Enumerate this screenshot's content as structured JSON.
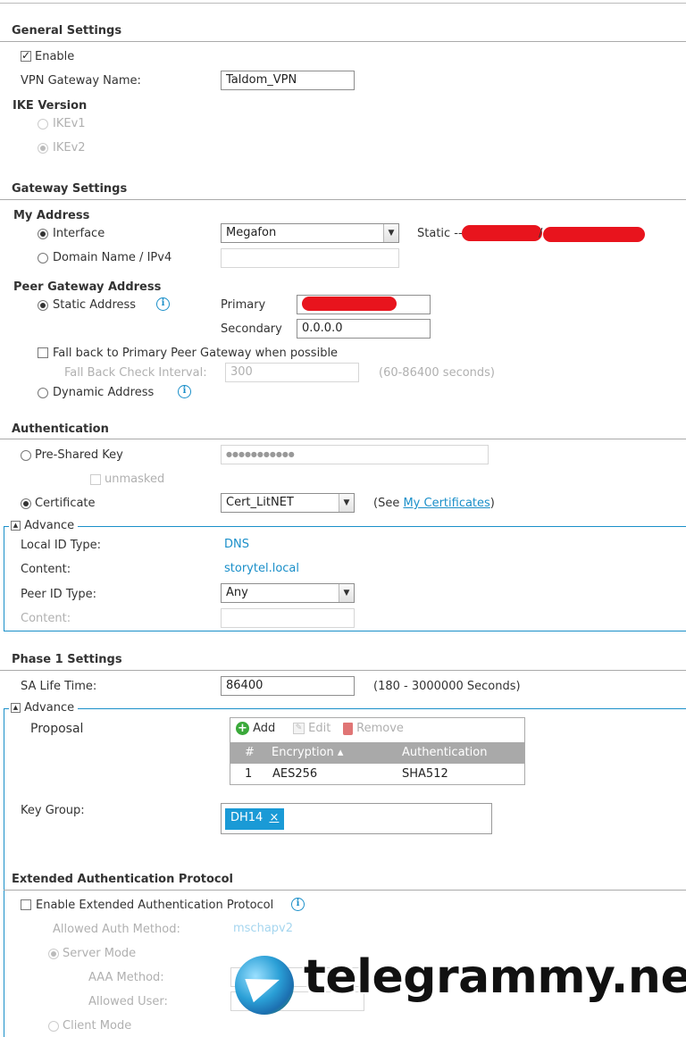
{
  "general": {
    "title": "General Settings",
    "enable_label": "Enable",
    "gateway_name_label": "VPN Gateway Name:",
    "gateway_name_value": "Taldom_VPN",
    "ike_title": "IKE Version",
    "ikev1": "IKEv1",
    "ikev2": "IKEv2"
  },
  "gateway": {
    "title": "Gateway Settings",
    "my_address_title": "My Address",
    "interface_label": "Interface",
    "interface_value": "Megafon",
    "static_label": "Static --",
    "static_sep": "/",
    "domain_label": "Domain Name / IPv4",
    "peer_title": "Peer Gateway Address",
    "static_address_label": "Static Address",
    "primary_label": "Primary",
    "secondary_label": "Secondary",
    "secondary_value": "0.0.0.0",
    "fallback_label": "Fall back to Primary Peer Gateway when possible",
    "fallback_interval_label": "Fall Back Check Interval:",
    "fallback_interval_value": "300",
    "fallback_range": "(60-86400 seconds)",
    "dynamic_label": "Dynamic Address"
  },
  "auth": {
    "title": "Authentication",
    "psk_label": "Pre-Shared Key",
    "psk_value": "●●●●●●●●●●●",
    "unmasked_label": "unmasked",
    "cert_label": "Certificate",
    "cert_value": "Cert_LitNET",
    "see_prefix": "(See ",
    "see_link": "My Certificates",
    "see_suffix": ")",
    "advance_label": "Advance",
    "local_id_label": "Local ID Type:",
    "local_id_value": "DNS",
    "content_label": "Content:",
    "content_value": "storytel.local",
    "peer_id_label": "Peer ID Type:",
    "peer_id_value": "Any",
    "peer_content_label": "Content:"
  },
  "phase1": {
    "title": "Phase 1 Settings",
    "sa_label": "SA Life Time:",
    "sa_value": "86400",
    "sa_range": "(180 - 3000000 Seconds)",
    "advance_label": "Advance",
    "proposal_label": "Proposal",
    "add_label": "Add",
    "edit_label": "Edit",
    "remove_label": "Remove",
    "columns": [
      "#",
      "Encryption ▴",
      "Authentication"
    ],
    "rows": [
      [
        "1",
        "AES256",
        "SHA512"
      ]
    ],
    "key_group_label": "Key Group:",
    "key_group_tag": "DH14",
    "key_group_tag_close": "×"
  },
  "xauth": {
    "title": "Extended Authentication Protocol",
    "enable_label": "Enable Extended Authentication Protocol",
    "allowed_method_label": "Allowed Auth Method:",
    "allowed_method_value": "mschapv2",
    "server_mode_label": "Server Mode",
    "aaa_label": "AAA Method:",
    "allowed_user_label": "Allowed User:",
    "client_mode_label": "Client Mode"
  },
  "watermark": {
    "text": "telegrammy.net"
  },
  "colors": {
    "accent": "#1a8fc9",
    "redaction": "#e8141d",
    "tag_bg": "#1a9ad6",
    "grid_header": "#a9a9a9"
  }
}
